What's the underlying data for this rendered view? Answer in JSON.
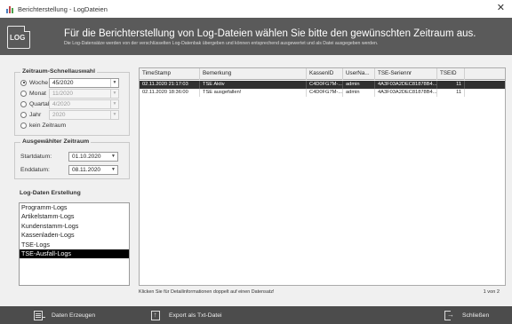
{
  "window": {
    "title": "Berichterstellung - LogDateien",
    "close_glyph": "✕"
  },
  "header": {
    "icon_text": "LOG",
    "title": "Für die Berichterstellung von Log-Dateien wählen Sie bitte den gewünschten Zeitraum aus.",
    "subtitle": "Die Log-Datensätze werden von der verschlüsselten Log-Datenbak übergeben und können entsprechend ausgewertet und als Datei ausgegeben werden."
  },
  "quick_select": {
    "legend": "Zeitraum-Schnellauswahl",
    "options": [
      {
        "label": "Woche",
        "value": "45/2020",
        "checked": true,
        "enabled": true
      },
      {
        "label": "Monat",
        "value": "11/2020",
        "checked": false,
        "enabled": false
      },
      {
        "label": "Quartal",
        "value": "4/2020",
        "checked": false,
        "enabled": false
      },
      {
        "label": "Jahr",
        "value": "2020",
        "checked": false,
        "enabled": false
      },
      {
        "label": "kein Zeitraum",
        "value": null,
        "checked": false,
        "enabled": false
      }
    ]
  },
  "period": {
    "legend": "Ausgewählter Zeitraum",
    "start_label": "Startdatum:",
    "start_value": "01.10.2020",
    "end_label": "Enddatum:",
    "end_value": "08.11.2020"
  },
  "log_list": {
    "title": "Log-Daten Erstellung",
    "items": [
      "Programm-Logs",
      "Artikelstamm-Logs",
      "Kundenstamm-Logs",
      "Kassenladen-Logs",
      "TSE-Logs",
      "TSE-Ausfall-Logs"
    ],
    "selected_index": 5
  },
  "grid": {
    "columns": [
      "TimeStamp",
      "Bemerkung",
      "KassenID",
      "UserNa...",
      "TSE-Seriennr",
      "TSEID"
    ],
    "rows": [
      {
        "timestamp": "02.11.2020 21:17:03",
        "bemerkung": "TSE Aktiv",
        "kassenid": "C4D0FG7M-...",
        "user": "admin",
        "tse_serial": "4A3F03A2DEC81878B4...",
        "tseid": "11",
        "selected": true
      },
      {
        "timestamp": "02.11.2020 18:36:00",
        "bemerkung": "TSE ausgefallen!",
        "kassenid": "C4D0FG7M-...",
        "user": "admin",
        "tse_serial": "4A3F03A2DEC81878B4...",
        "tseid": "11",
        "selected": false
      }
    ]
  },
  "status": {
    "hint": "Klicken Sie für Detailinformationen doppelt auf einen Datensatz!",
    "page": "1 von 2"
  },
  "footer": {
    "generate_label": "Daten Erzeugen",
    "export_label": "Export als Txt-Datei",
    "close_label": "Schließen"
  },
  "icons": {
    "app": "bar-chart-icon",
    "header": "log-file-icon",
    "generate": "list-export-icon",
    "export": "file-upload-icon",
    "close": "exit-door-icon"
  }
}
